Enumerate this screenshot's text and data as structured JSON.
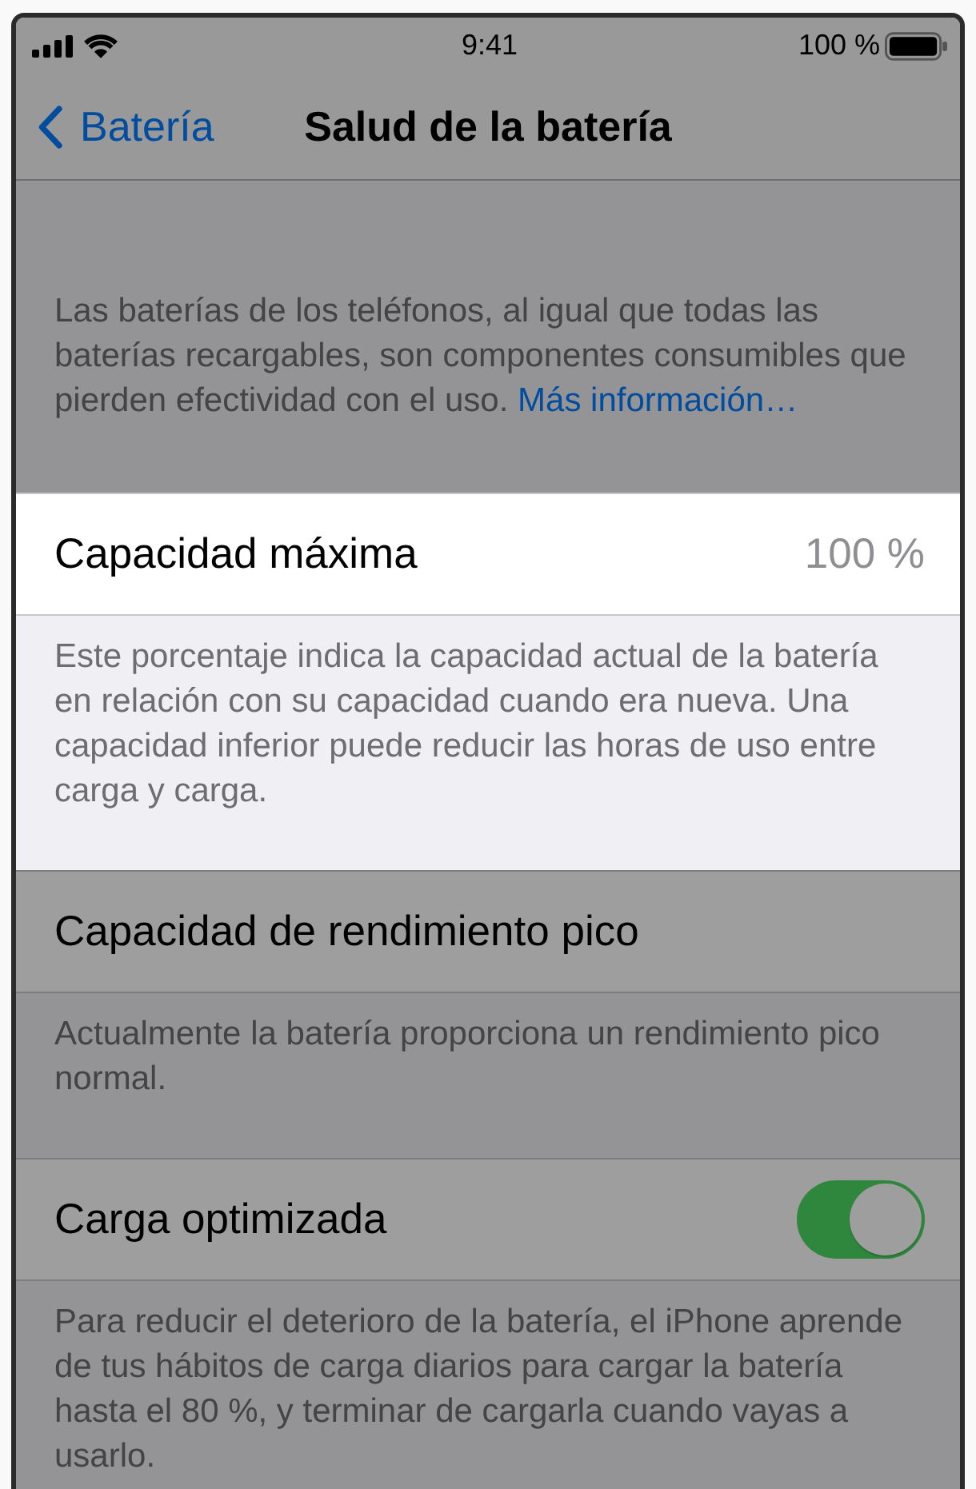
{
  "dim_overlay": true,
  "status_bar": {
    "time": "9:41",
    "battery": "100 %"
  },
  "nav_bar": {
    "back": "Batería",
    "title": "Salud de la batería"
  },
  "intro": {
    "text": "Las baterías de los teléfonos, al igual que todas las baterías recargables, son componentes consumibles que pierden efectividad con el uso.",
    "link": "Más información…"
  },
  "sections": [
    {
      "kind": "value",
      "label": "Capacidad máxima",
      "value": "100 %",
      "footer": "Este porcentaje indica la capacidad actual de la batería en relación con su capacidad cuando era nueva. Una capacidad inferior puede reducir las horas de uso entre carga y carga.",
      "highlighted": true
    },
    {
      "kind": "plain",
      "label": "Capacidad de rendimiento pico",
      "footer": "Actualmente la batería proporciona un rendimiento pico normal.",
      "highlighted": false
    },
    {
      "kind": "toggle",
      "label": "Carga optimizada",
      "on": true,
      "footer": "Para reducir el deterioro de la batería, el iPhone aprende de tus hábitos de carga diarios para cargar la batería hasta el 80 %, y terminar de cargarla cuando vayas a usarlo.",
      "highlighted": false
    }
  ]
}
